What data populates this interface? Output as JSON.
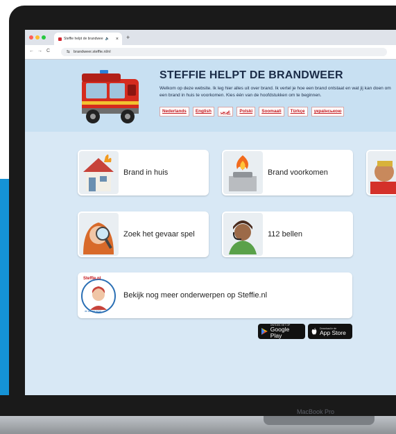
{
  "browser": {
    "tab_title": "Steffie helpt de brandwee",
    "tab_close": "×",
    "new_tab": "+",
    "url": "brandweer.steffie.nl/nl",
    "nav": {
      "back": "←",
      "forward": "→",
      "reload": "C",
      "site_info": "⇆"
    },
    "mute_icon": "🔈"
  },
  "page": {
    "title": "STEFFIE HELPT DE BRANDWEER",
    "intro": "Welkom op deze website. Ik leg hier alles uit over brand. Ik vertel je hoe een brand ontstaat en wat jij kan doen om een brand in huis te voorkomen. Kies één van de hoofdstukken om te beginnen.",
    "languages": [
      "Nederlands",
      "English",
      "عربي",
      "Polski",
      "Soomaali",
      "Türkçe",
      "українською"
    ],
    "cards": [
      {
        "label": "Brand in huis",
        "icon": "house-fire-icon"
      },
      {
        "label": "Brand voorkomen",
        "icon": "stove-fire-icon"
      },
      {
        "label": "Zoek het gevaar spel",
        "icon": "magnifier-girl-icon"
      },
      {
        "label": "112 bellen",
        "icon": "operator-headset-icon"
      },
      {
        "label": "Bekijk nog meer onderwerpen op Steffie.nl",
        "icon": "steffie-logo-icon"
      }
    ],
    "steffie_logo_text": "Steffie.nl",
    "steffie_logo_sub": "de wereld helpt",
    "google_play": {
      "small": "ONTDEK HET OP",
      "big": "Google Play"
    },
    "app_store": {
      "small": "Download in de",
      "big": "App Store"
    }
  },
  "device": {
    "brand": "MacBook Pro"
  },
  "colors": {
    "accent_blue": "#1593d6",
    "page_bg": "#d8e8f5",
    "header_bg": "#c8e0f2",
    "lang_red": "#c4161c",
    "title_navy": "#1a2b47"
  }
}
